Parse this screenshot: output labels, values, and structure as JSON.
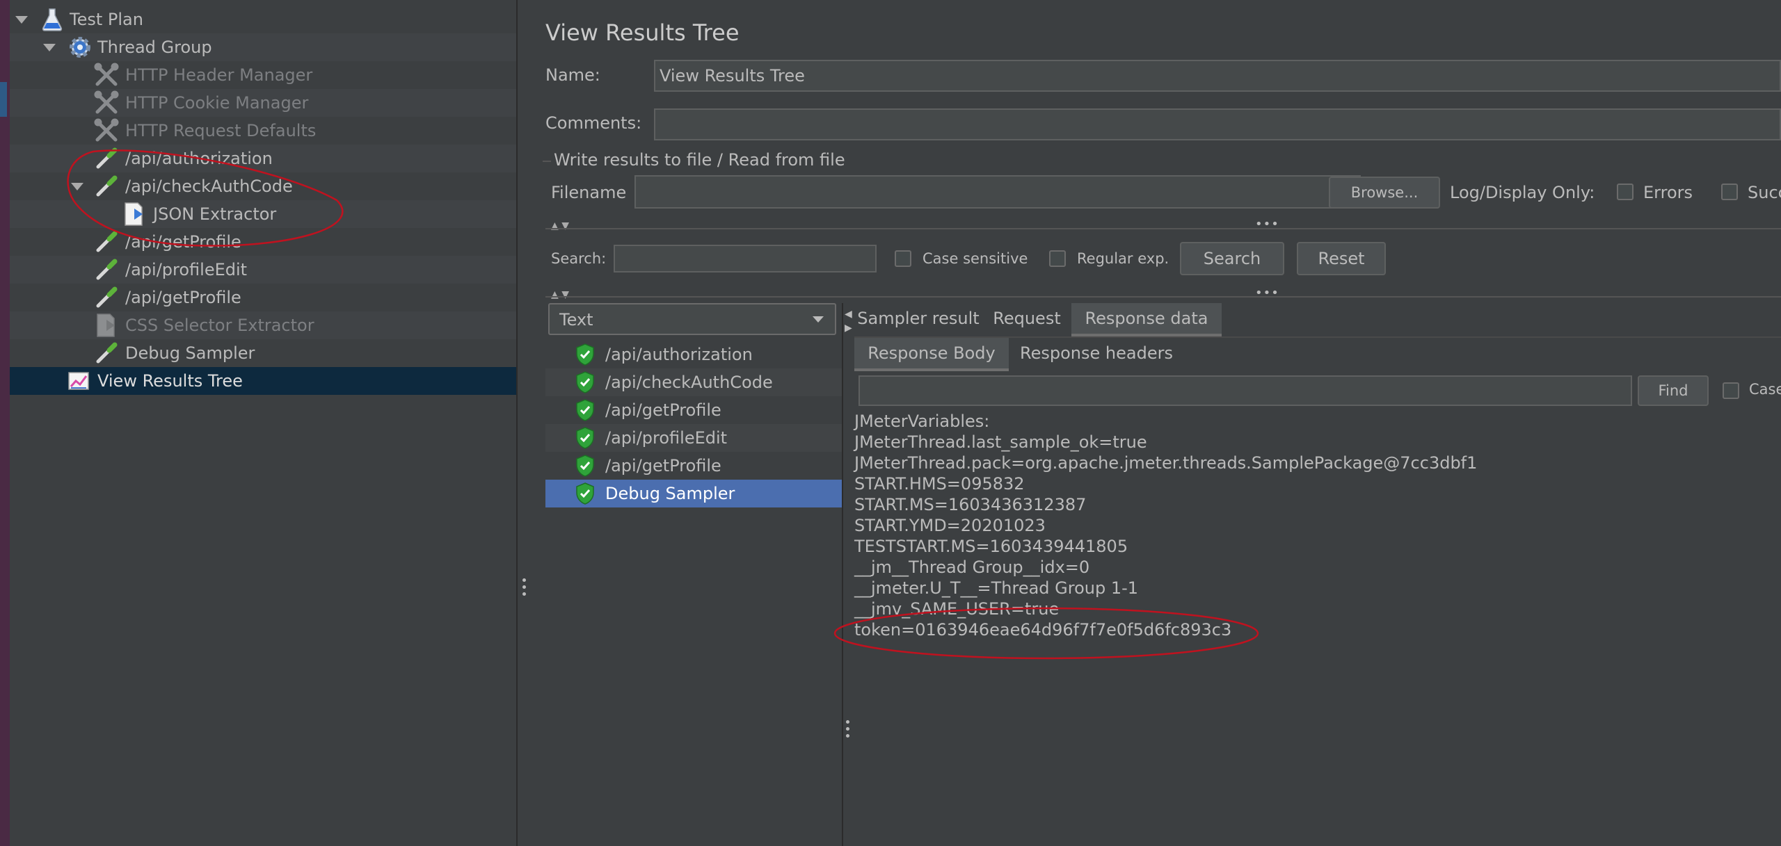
{
  "tree": {
    "items": [
      {
        "label": "Test Plan",
        "icon": "flask-icon",
        "state": "normal"
      },
      {
        "label": "Thread Group",
        "icon": "gear-icon",
        "state": "normal"
      },
      {
        "label": "HTTP Header Manager",
        "icon": "wrench-icon",
        "state": "disabled"
      },
      {
        "label": "HTTP Cookie Manager",
        "icon": "wrench-icon",
        "state": "disabled"
      },
      {
        "label": "HTTP Request Defaults",
        "icon": "wrench-icon",
        "state": "disabled"
      },
      {
        "label": "/api/authorization",
        "icon": "pipette-icon",
        "state": "normal"
      },
      {
        "label": "/api/checkAuthCode",
        "icon": "pipette-icon",
        "state": "normal"
      },
      {
        "label": "JSON Extractor",
        "icon": "extractor-icon",
        "state": "normal"
      },
      {
        "label": "/api/getProfile",
        "icon": "pipette-icon",
        "state": "normal"
      },
      {
        "label": "/api/profileEdit",
        "icon": "pipette-icon",
        "state": "normal"
      },
      {
        "label": "/api/getProfile",
        "icon": "pipette-icon",
        "state": "normal"
      },
      {
        "label": "CSS Selector Extractor",
        "icon": "extractor-icon",
        "state": "disabled"
      },
      {
        "label": "Debug Sampler",
        "icon": "pipette-icon",
        "state": "normal"
      },
      {
        "label": "View Results Tree",
        "icon": "chart-icon",
        "state": "selected"
      }
    ]
  },
  "panel": {
    "title": "View Results Tree",
    "name_label": "Name:",
    "name_value": "View Results Tree",
    "comments_label": "Comments:",
    "comments_value": "",
    "file_group_title": "Write results to file / Read from file",
    "filename_label": "Filename",
    "filename_value": "",
    "browse_label": "Browse...",
    "log_display_label": "Log/Display Only:",
    "errors_label": "Errors",
    "successes_label": "Succ"
  },
  "search": {
    "label": "Search:",
    "value": "",
    "case_sensitive_label": "Case sensitive",
    "regexp_label": "Regular exp.",
    "search_button": "Search",
    "reset_button": "Reset"
  },
  "renderer": {
    "selected": "Text"
  },
  "results": {
    "items": [
      {
        "label": "/api/authorization",
        "status": "success"
      },
      {
        "label": "/api/checkAuthCode",
        "status": "success"
      },
      {
        "label": "/api/getProfile",
        "status": "success"
      },
      {
        "label": "/api/profileEdit",
        "status": "success"
      },
      {
        "label": "/api/getProfile",
        "status": "success"
      },
      {
        "label": "Debug Sampler",
        "status": "success",
        "selected": true
      }
    ]
  },
  "tabs": {
    "main": [
      "Sampler result",
      "Request",
      "Response data"
    ],
    "sub": [
      "Response Body",
      "Response headers"
    ]
  },
  "find": {
    "value": "",
    "button": "Find",
    "case_label": "Case"
  },
  "response_lines": [
    "JMeterVariables:",
    "JMeterThread.last_sample_ok=true",
    "JMeterThread.pack=org.apache.jmeter.threads.SamplePackage@7cc3dbf1",
    "START.HMS=095832",
    "START.MS=1603436312387",
    "START.YMD=20201023",
    "TESTSTART.MS=1603439441805",
    "__jm__Thread Group__idx=0",
    "__jmeter.U_T__=Thread Group 1-1",
    "__jmv_SAME_USER=true",
    "token=0163946eae64d96f7f7e0f5d6fc893c3"
  ],
  "colors": {
    "annotation": "#c0121f",
    "selection": "#4b6eaf",
    "tree_selection": "#0d293e",
    "success_green": "#3aa53a"
  }
}
